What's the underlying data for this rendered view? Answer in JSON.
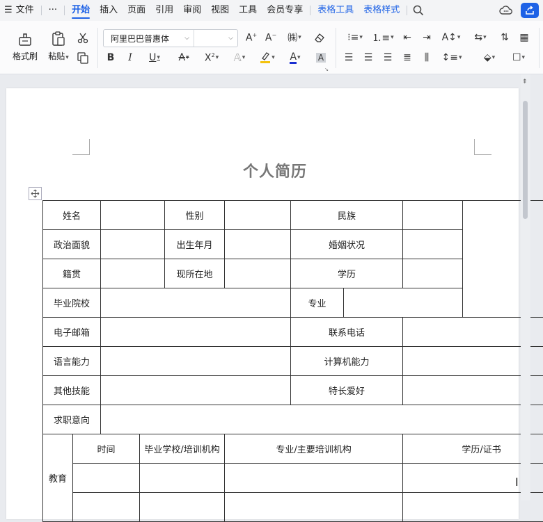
{
  "menu": {
    "hamburger_icon": "menu-icon",
    "file_label": "文件",
    "more_label": "···",
    "tabs": [
      "开始",
      "插入",
      "页面",
      "引用",
      "审阅",
      "视图",
      "工具",
      "会员专享"
    ],
    "active_tab": "开始",
    "context_tabs": [
      "表格工具",
      "表格样式"
    ]
  },
  "ribbon": {
    "format_painter": "格式刷",
    "paste": "粘贴",
    "font_name": "阿里巴巴普惠体",
    "font_size": ""
  },
  "document": {
    "title": "个人简历",
    "rows": {
      "name": "姓名",
      "gender": "性别",
      "ethnicity": "民族",
      "political": "政治面貌",
      "birth": "出生年月",
      "marital": "婚姻状况",
      "native_place": "籍贯",
      "residence": "现所在地",
      "education_level": "学历",
      "school": "毕业院校",
      "major": "专业",
      "email": "电子邮箱",
      "phone": "联系电话",
      "language": "语言能力",
      "computer": "计算机能力",
      "other_skills": "其他技能",
      "hobbies": "特长爱好",
      "job_intention": "求职意向",
      "education": "教育",
      "edu_time": "时间",
      "edu_school": "毕业学校/培训机构",
      "edu_major": "专业/主要培训机构",
      "edu_degree": "学历/证书"
    }
  },
  "colors": {
    "accent": "#1e62e6",
    "title_gray": "#777777"
  }
}
